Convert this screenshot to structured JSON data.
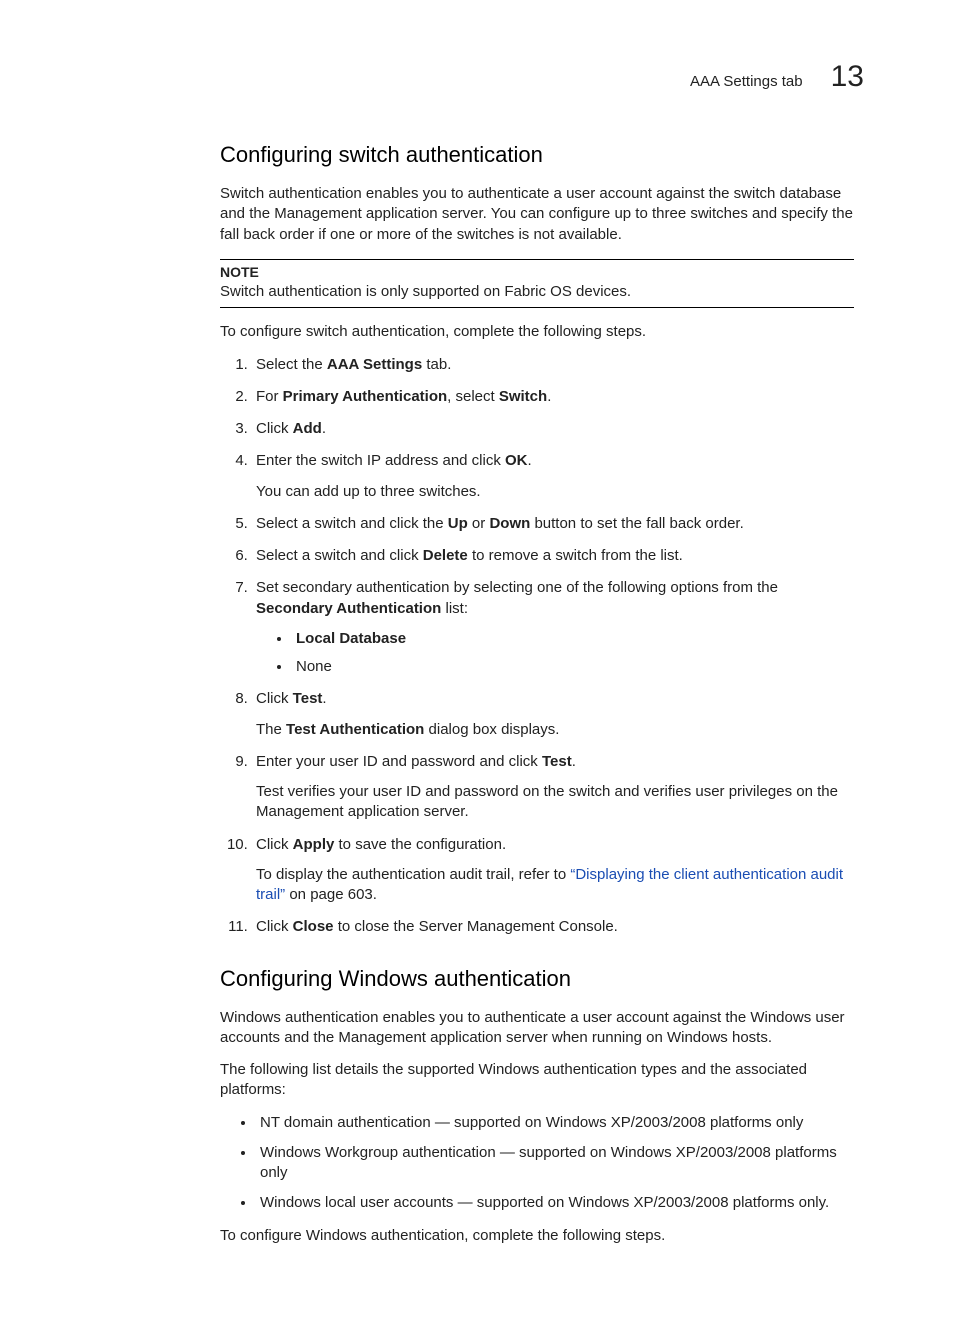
{
  "header": {
    "tab_label": "AAA Settings tab",
    "chapter_number": "13"
  },
  "section1": {
    "title": "Configuring switch authentication",
    "intro": "Switch authentication enables you to authenticate a user account against the switch database and the Management application server. You can configure up to three switches and specify the fall back order if one or more of the switches is not available.",
    "note_label": "NOTE",
    "note_text": "Switch authentication is only supported on Fabric OS devices.",
    "lead_in": "To configure switch authentication, complete the following steps.",
    "steps": {
      "s1_a": "Select the ",
      "s1_b": "AAA Settings",
      "s1_c": " tab.",
      "s2_a": "For ",
      "s2_b": "Primary Authentication",
      "s2_c": ", select ",
      "s2_d": "Switch",
      "s2_e": ".",
      "s3_a": "Click ",
      "s3_b": "Add",
      "s3_c": ".",
      "s4_a": "Enter the switch IP address and click ",
      "s4_b": "OK",
      "s4_c": ".",
      "s4_sub": "You can add up to three switches.",
      "s5_a": "Select a switch and click the ",
      "s5_b": "Up",
      "s5_c": " or ",
      "s5_d": "Down",
      "s5_e": " button to set the fall back order.",
      "s6_a": "Select a switch and click ",
      "s6_b": "Delete",
      "s6_c": " to remove a switch from the list.",
      "s7_a": "Set secondary authentication by selecting one of the following options from the ",
      "s7_b": "Secondary Authentication",
      "s7_c": " list:",
      "s7_opt1": "Local Database",
      "s7_opt2": "None",
      "s8_a": "Click ",
      "s8_b": "Test",
      "s8_c": ".",
      "s8_sub_a": "The ",
      "s8_sub_b": "Test Authentication",
      "s8_sub_c": " dialog box displays.",
      "s9_a": "Enter your user ID and password and click ",
      "s9_b": "Test",
      "s9_c": ".",
      "s9_sub": "Test verifies your user ID and password on the switch and verifies user privileges on the Management application server.",
      "s10_a": "Click ",
      "s10_b": "Apply",
      "s10_c": " to save the configuration.",
      "s10_sub_a": "To display the authentication audit trail, refer to ",
      "s10_sub_link": "“Displaying the client authentication audit trail”",
      "s10_sub_b": " on page 603.",
      "s11_a": "Click ",
      "s11_b": "Close",
      "s11_c": " to close the Server Management Console."
    }
  },
  "section2": {
    "title": "Configuring Windows authentication",
    "intro": "Windows authentication enables you to authenticate a user account against the Windows user accounts and the Management application server when running on Windows hosts.",
    "list_lead": "The following list details the supported Windows authentication types and the associated platforms:",
    "bullets": {
      "b1": "NT domain authentication — supported on Windows XP/2003/2008 platforms only",
      "b2": "Windows Workgroup authentication — supported on Windows XP/2003/2008 platforms only",
      "b3": "Windows local user accounts — supported on Windows XP/2003/2008 platforms only."
    },
    "lead_in": "To configure Windows authentication, complete the following steps."
  }
}
